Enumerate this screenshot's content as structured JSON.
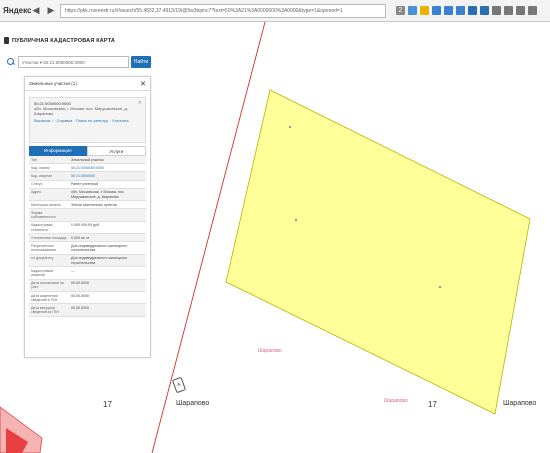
{
  "browser": {
    "logo": "Яндекс",
    "back": "◀",
    "forward": "▶",
    "address": "https://pkk.rosreestr.ru/#/search/55.4832,37.4913/19/@5w3tqxnc7?text=50%3A21%3A0000000%3A0000&type=1&opened=1",
    "address_host": "pkk.rosreestr.ru",
    "tab_count": "2"
  },
  "page": {
    "title": "ПУБЛИЧНАЯ КАДАСТРОВАЯ КАРТА"
  },
  "search": {
    "type_label": "Участки ▾",
    "query": "50:21:0000000:0000",
    "button_label": "Найти"
  },
  "panel": {
    "header": "Земельные участки (1)",
    "close": "✕",
    "card": {
      "number": "50:21:0000000:0000",
      "address": "обл. Московская, г. Москва, пос. Марушкинское, д.",
      "address2": "Шарапово",
      "close": "✕",
      "links": "Выписка ↓ · Справка · Поиск по реестру · Уточнить"
    },
    "tabs": [
      {
        "label": "Информация",
        "active": true
      },
      {
        "label": "Услуги",
        "active": false
      }
    ],
    "rows": [
      {
        "k": "Тип",
        "v": "Земельный участок",
        "link": false
      },
      {
        "k": "Кад. номер",
        "v": "50:21:0000000:0000",
        "link": true
      },
      {
        "k": "Кад. квартал",
        "v": "50:21:0000000",
        "link": true
      },
      {
        "k": "Статус",
        "v": "Ранее учтенный",
        "link": false
      },
      {
        "k": "Адрес",
        "v": "обл. Московская, г. Москва, пос. Марушкинское, д. Шарапово",
        "link": false
      },
      {
        "k": "Категория земель",
        "v": "Земли населенных пунктов",
        "link": false
      },
      {
        "k": "Форма собственности",
        "v": "",
        "link": false
      },
      {
        "k": "Кадастровая стоимость",
        "v": "0 000 000,00 руб.",
        "link": false
      },
      {
        "k": "Уточненная площадь",
        "v": "0 000 кв. м",
        "link": false
      },
      {
        "k": "Разрешенное использование",
        "v": "Для индивидуального жилищного строительства",
        "link": false
      },
      {
        "k": "по документу",
        "v": "Для индивидуального жилищного строительства",
        "link": false
      },
      {
        "k": "Кадастровый инженер",
        "v": "—",
        "link": false
      },
      {
        "k": "Дата постановки на учет",
        "v": "00.00.0000",
        "link": false
      },
      {
        "k": "Дата изменения сведений в ГКН",
        "v": "00.00.0000",
        "link": false
      },
      {
        "k": "Дата выгрузки сведений из ГКН",
        "v": "00.00.0000",
        "link": false
      }
    ]
  },
  "map": {
    "parcel_fill": "#ffff99",
    "parcel_stroke": "#b5b500",
    "boundary_color": "#d43030",
    "labels": {
      "parcel_label_1": "Шарапово",
      "parcel_label_2": "Шарапово",
      "num_left": "17",
      "num_right": "17",
      "place_left": "Шарапово",
      "place_right": "Шарапово",
      "marker": "А"
    }
  }
}
